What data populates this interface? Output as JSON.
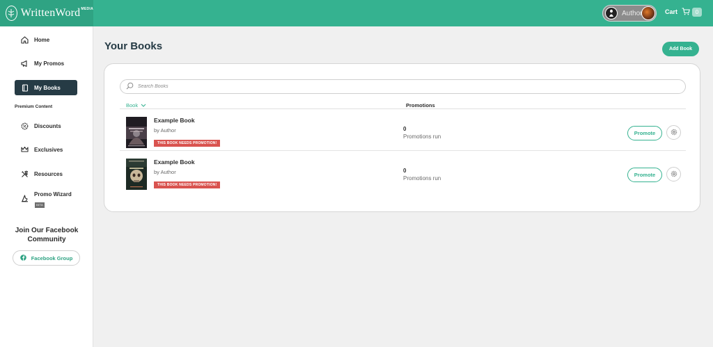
{
  "brand": {
    "name": "WrittenWord",
    "superscript": "MEDIA"
  },
  "header": {
    "role_label": "Author",
    "cart_label": "Cart",
    "cart_count": "0"
  },
  "sidebar": {
    "items": [
      {
        "label": "Home",
        "icon": "home-icon"
      },
      {
        "label": "My Promos",
        "icon": "megaphone-icon"
      },
      {
        "label": "My Books",
        "icon": "book-icon",
        "active": true
      },
      {
        "label": "Discounts",
        "icon": "discount-badge-icon"
      },
      {
        "label": "Exclusives",
        "icon": "crown-icon"
      },
      {
        "label": "Resources",
        "icon": "tools-icon"
      },
      {
        "label": "Promo Wizard",
        "icon": "wizard-hat-icon",
        "badge": "BETA"
      }
    ],
    "section_label": "Premium Content",
    "facebook_title": "Join Our Facebook Community",
    "facebook_button": "Facebook Group"
  },
  "main": {
    "title": "Your Books",
    "add_book_label": "Add Book",
    "search_placeholder": "Search Books",
    "columns": {
      "book": "Book",
      "promotions": "Promotions"
    },
    "rows": [
      {
        "title": "Example Book",
        "author": "by Author",
        "badge": "THIS BOOK NEEDS PROMOTION!",
        "promotions": "0",
        "promotions_label": "Promotions run",
        "action": "Promote"
      },
      {
        "title": "Example Book",
        "author": "by Author",
        "badge": "THIS BOOK NEEDS PROMOTION!",
        "promotions": "0",
        "promotions_label": "Promotions run",
        "action": "Promote"
      }
    ]
  },
  "colors": {
    "accent": "#35b290",
    "brand_dark": "#2fa383",
    "nav_active": "#263b45",
    "badge_red": "#d9534f"
  }
}
